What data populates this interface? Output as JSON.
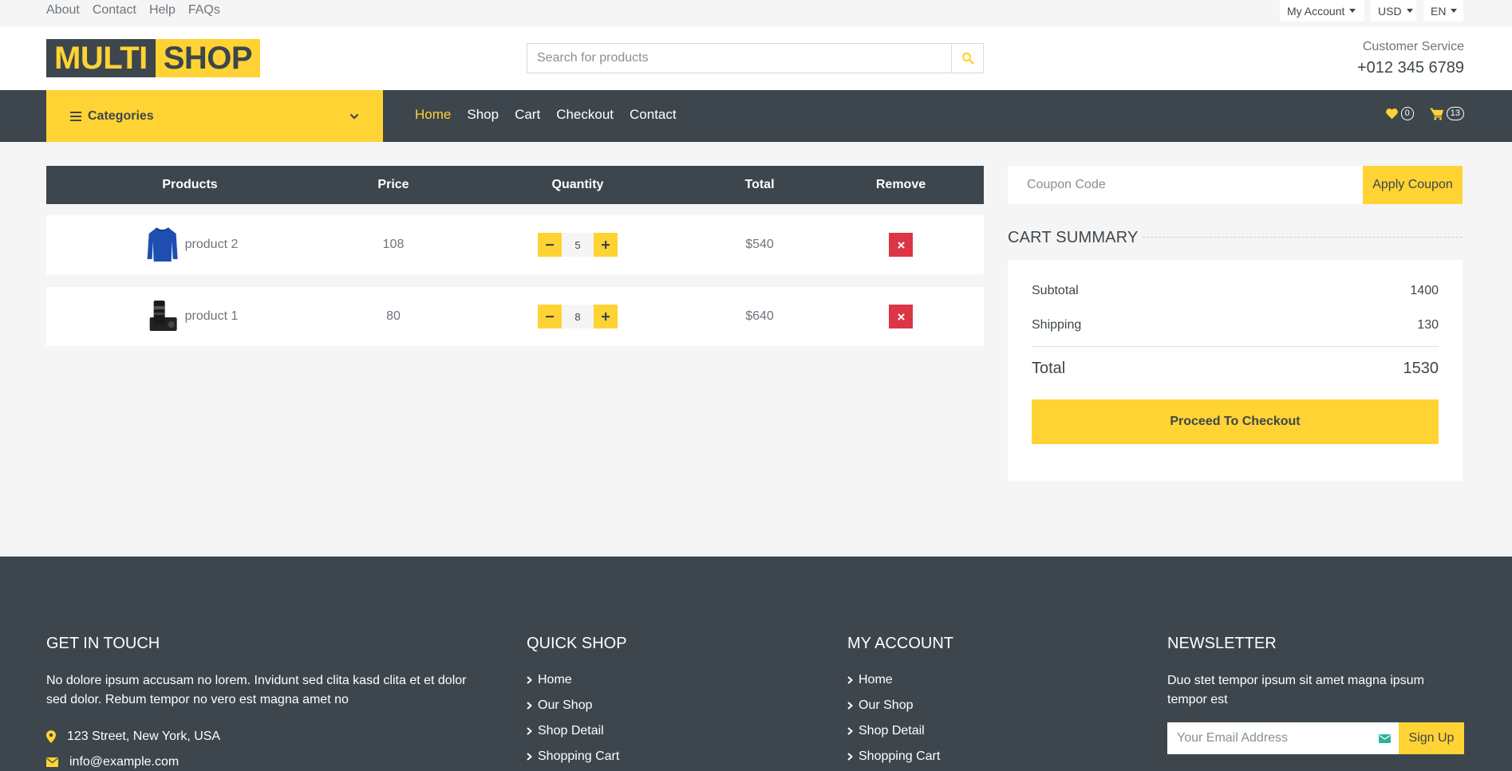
{
  "topbar": {
    "links": [
      "About",
      "Contact",
      "Help",
      "FAQs"
    ],
    "account_label": "My Account",
    "currency_label": "USD",
    "language_label": "EN"
  },
  "header": {
    "logo_part1": "MULTI",
    "logo_part2": "SHOP",
    "search_placeholder": "Search for products",
    "customer_service_label": "Customer Service",
    "phone": "+012 345 6789"
  },
  "nav": {
    "categories_label": "Categories",
    "items": [
      "Home",
      "Shop",
      "Cart",
      "Checkout",
      "Contact"
    ],
    "active_item": "Home",
    "wishlist_count": "0",
    "cart_count": "13"
  },
  "cart": {
    "headers": [
      "Products",
      "Price",
      "Quantity",
      "Total",
      "Remove"
    ],
    "rows": [
      {
        "name": "product 2",
        "image": "blue-sweater",
        "price": "108",
        "quantity": "5",
        "total": "$540"
      },
      {
        "name": "product 1",
        "image": "camera",
        "price": "80",
        "quantity": "8",
        "total": "$640"
      }
    ]
  },
  "coupon": {
    "placeholder": "Coupon Code",
    "button_label": "Apply Coupon"
  },
  "summary": {
    "title": "CART SUMMARY",
    "subtotal_label": "Subtotal",
    "subtotal_value": "1400",
    "shipping_label": "Shipping",
    "shipping_value": "130",
    "total_label": "Total",
    "total_value": "1530",
    "checkout_label": "Proceed To Checkout"
  },
  "footer": {
    "get_in_touch": {
      "title": "GET IN TOUCH",
      "text": "No dolore ipsum accusam no lorem. Invidunt sed clita kasd clita et et dolor sed dolor. Rebum tempor no vero est magna amet no",
      "address": "123 Street, New York, USA",
      "email": "info@example.com"
    },
    "quick_shop": {
      "title": "QUICK SHOP",
      "links": [
        "Home",
        "Our Shop",
        "Shop Detail",
        "Shopping Cart"
      ]
    },
    "my_account": {
      "title": "MY ACCOUNT",
      "links": [
        "Home",
        "Our Shop",
        "Shop Detail",
        "Shopping Cart"
      ]
    },
    "newsletter": {
      "title": "NEWSLETTER",
      "text": "Duo stet tempor ipsum sit amet magna ipsum tempor est",
      "placeholder": "Your Email Address",
      "button_label": "Sign Up"
    }
  },
  "colors": {
    "accent": "#ffd333",
    "dark": "#3d464d",
    "danger": "#dc3545",
    "background": "#f5f5f5"
  }
}
